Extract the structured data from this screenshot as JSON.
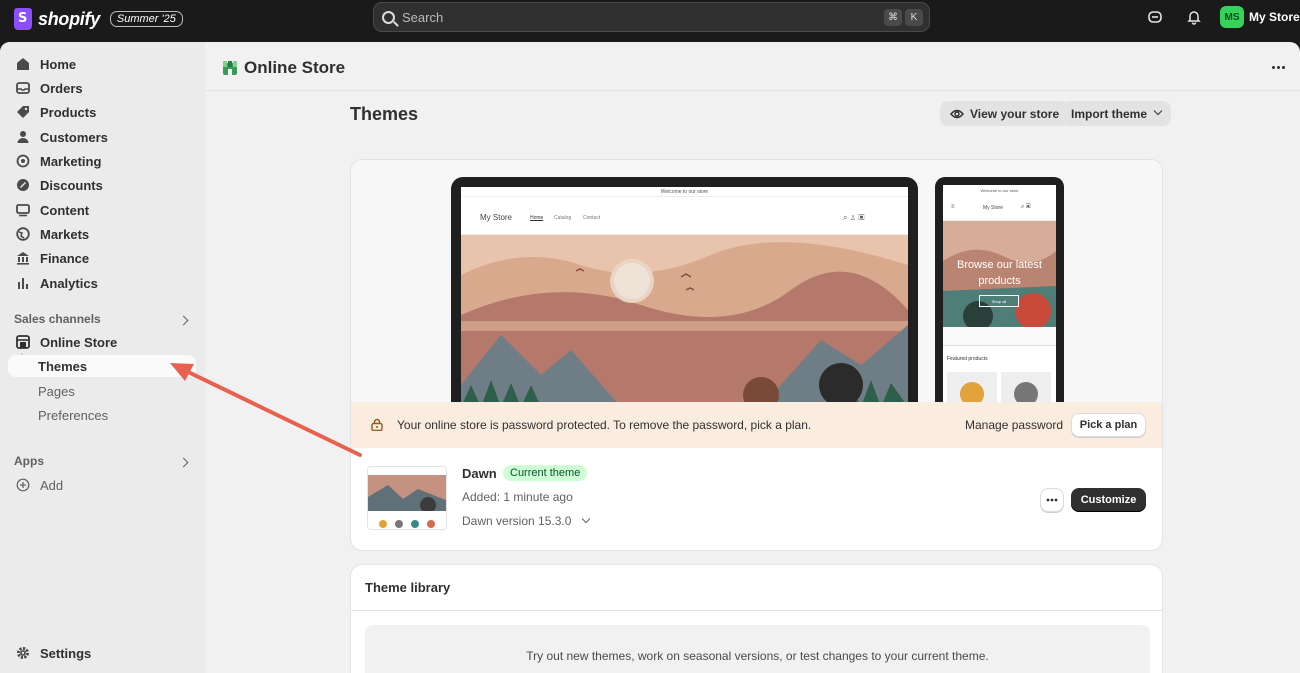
{
  "topbar": {
    "brand": "shopify",
    "edition": "Summer '25",
    "search_placeholder": "Search",
    "kbd_cmd": "⌘",
    "kbd_k": "K",
    "avatar_initials": "MS",
    "store_name": "My Store"
  },
  "sidebar": {
    "items": [
      {
        "label": "Home",
        "icon": "home-icon"
      },
      {
        "label": "Orders",
        "icon": "inbox-icon"
      },
      {
        "label": "Products",
        "icon": "tag-icon"
      },
      {
        "label": "Customers",
        "icon": "person-icon"
      },
      {
        "label": "Marketing",
        "icon": "target-icon"
      },
      {
        "label": "Discounts",
        "icon": "discount-icon"
      },
      {
        "label": "Content",
        "icon": "content-icon"
      },
      {
        "label": "Markets",
        "icon": "globe-icon"
      },
      {
        "label": "Finance",
        "icon": "bank-icon"
      },
      {
        "label": "Analytics",
        "icon": "bar-chart-icon"
      }
    ],
    "sales_channels_label": "Sales channels",
    "online_store": "Online Store",
    "sub_items": [
      "Themes",
      "Pages",
      "Preferences"
    ],
    "apps_label": "Apps",
    "add_label": "Add",
    "settings_label": "Settings"
  },
  "main": {
    "page_title": "Online Store",
    "themes_title": "Themes",
    "view_store": "View your store",
    "import_theme": "Import theme",
    "preview": {
      "announcement": "Welcome to our store",
      "store_name": "My Store",
      "nav": [
        "Home",
        "Catalog",
        "Contact"
      ],
      "hero_text": "Browse our latest products",
      "shop_all": "Shop all",
      "featured": "Featured products"
    },
    "warning": {
      "text": "Your online store is password protected. To remove the password, pick a plan.",
      "manage": "Manage password",
      "pick_plan": "Pick a plan"
    },
    "current_theme": {
      "name": "Dawn",
      "badge": "Current theme",
      "added": "Added: 1 minute ago",
      "version": "Dawn version 15.3.0",
      "customize": "Customize"
    },
    "library": {
      "title": "Theme library",
      "text": "Try out new themes, work on seasonal versions, or test changes to your current theme."
    }
  },
  "colors": {
    "accent_arrow": "#e8614f",
    "badge_green": "#cdfed4",
    "warning_bg": "#fbece0"
  }
}
